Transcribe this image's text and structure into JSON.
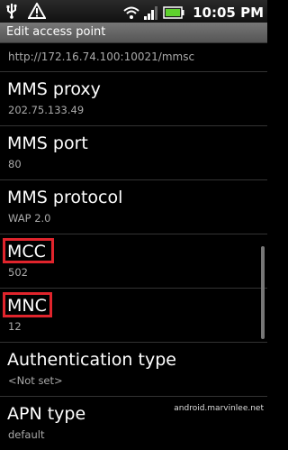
{
  "status_bar": {
    "icons": [
      "usb-icon",
      "warning-icon",
      "wifi-icon",
      "signal-icon",
      "battery-icon"
    ],
    "time": "10:05 PM"
  },
  "title": "Edit access point",
  "settings": [
    {
      "label": "",
      "value": "http://172.16.74.100:10021/mmsc"
    },
    {
      "label": "MMS proxy",
      "value": "202.75.133.49"
    },
    {
      "label": "MMS port",
      "value": "80"
    },
    {
      "label": "MMS protocol",
      "value": "WAP 2.0"
    },
    {
      "label": "MCC",
      "value": "502"
    },
    {
      "label": "MNC",
      "value": "12"
    },
    {
      "label": "Authentication type",
      "value": "<Not set>"
    },
    {
      "label": "APN type",
      "value": "default"
    }
  ],
  "highlight_color": "#e0242c",
  "watermark": "android.marvinlee.net"
}
